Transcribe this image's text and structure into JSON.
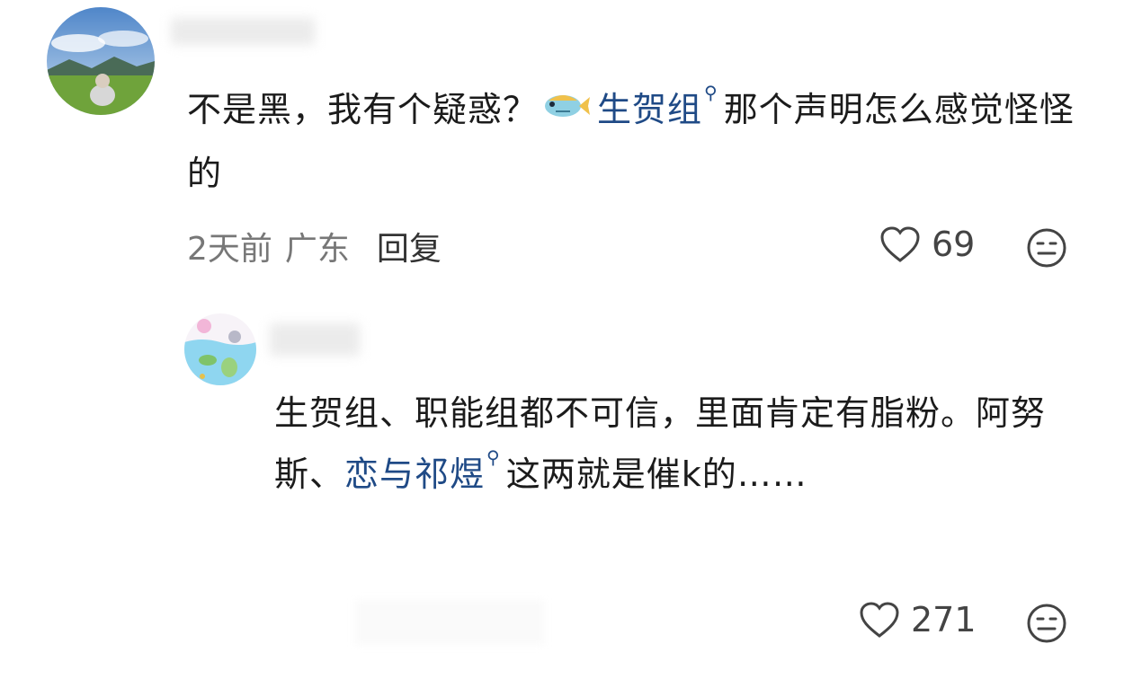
{
  "comments": [
    {
      "text_part1": "不是黑，我有个疑惑？",
      "link1": "生贺组",
      "text_part2": "那个声明怎么感觉怪怪的",
      "time": "2天前",
      "location": "广东",
      "reply_label": "回复",
      "likes": "69",
      "avatar_icon": "landscape-avatar-icon"
    },
    {
      "text_part1": "生贺组、职能组都不可信，里面肯定有脂粉。阿努斯、",
      "link1": "恋与祁煜",
      "text_part2": "这两就是催k的……",
      "likes": "271",
      "avatar_icon": "aquarium-avatar-icon"
    }
  ],
  "icons": {
    "link_search": "search-icon",
    "like": "heart-icon",
    "dislike": "neutral-face-icon",
    "fish": "fish-icon"
  },
  "colors": {
    "link": "#1f4a86",
    "meta": "#777777",
    "text": "#1b1b1b"
  }
}
